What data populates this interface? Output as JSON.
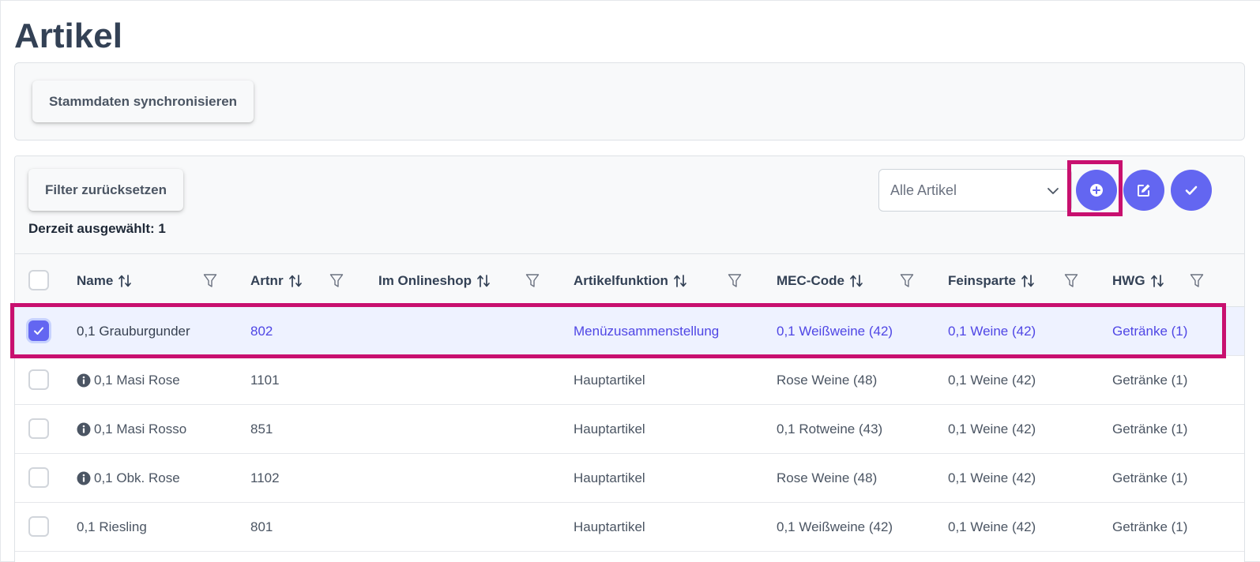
{
  "page": {
    "title": "Artikel"
  },
  "toolbar": {
    "sync_label": "Stammdaten synchronisieren"
  },
  "table": {
    "reset_label": "Filter zurücksetzen",
    "selected_text": "Derzeit ausgewählt: 1",
    "filter_select": {
      "selected": "Alle Artikel"
    },
    "columns": [
      {
        "label": "Name"
      },
      {
        "label": "Artnr"
      },
      {
        "label": "Im Onlineshop"
      },
      {
        "label": "Artikelfunktion"
      },
      {
        "label": "MEC-Code"
      },
      {
        "label": "Feinsparte"
      },
      {
        "label": "HWG"
      }
    ],
    "rows": [
      {
        "checked": true,
        "info": false,
        "name": "0,1 Grauburgunder",
        "artnr": "802",
        "onlineshop": "",
        "funktion": "Menüzusammenstellung",
        "mec": "0,1 Weißweine (42)",
        "feinsparte": "0,1 Weine (42)",
        "hwg": "Getränke (1)"
      },
      {
        "checked": false,
        "info": true,
        "name": "0,1 Masi Rose",
        "artnr": "1101",
        "onlineshop": "",
        "funktion": "Hauptartikel",
        "mec": "Rose Weine (48)",
        "feinsparte": "0,1 Weine (42)",
        "hwg": "Getränke (1)"
      },
      {
        "checked": false,
        "info": true,
        "name": "0,1 Masi Rosso",
        "artnr": "851",
        "onlineshop": "",
        "funktion": "Hauptartikel",
        "mec": "0,1 Rotweine (43)",
        "feinsparte": "0,1 Weine (42)",
        "hwg": "Getränke (1)"
      },
      {
        "checked": false,
        "info": true,
        "name": "0,1 Obk. Rose",
        "artnr": "1102",
        "onlineshop": "",
        "funktion": "Hauptartikel",
        "mec": "Rose Weine (48)",
        "feinsparte": "0,1 Weine (42)",
        "hwg": "Getränke (1)"
      },
      {
        "checked": false,
        "info": false,
        "name": "0,1 Riesling",
        "artnr": "801",
        "onlineshop": "",
        "funktion": "Hauptartikel",
        "mec": "0,1 Weißweine (42)",
        "feinsparte": "0,1 Weine (42)",
        "hwg": "Getränke (1)"
      }
    ]
  },
  "colors": {
    "accent": "#6366f1",
    "highlight": "#c8106f",
    "selected_row_bg": "#eef2ff"
  }
}
